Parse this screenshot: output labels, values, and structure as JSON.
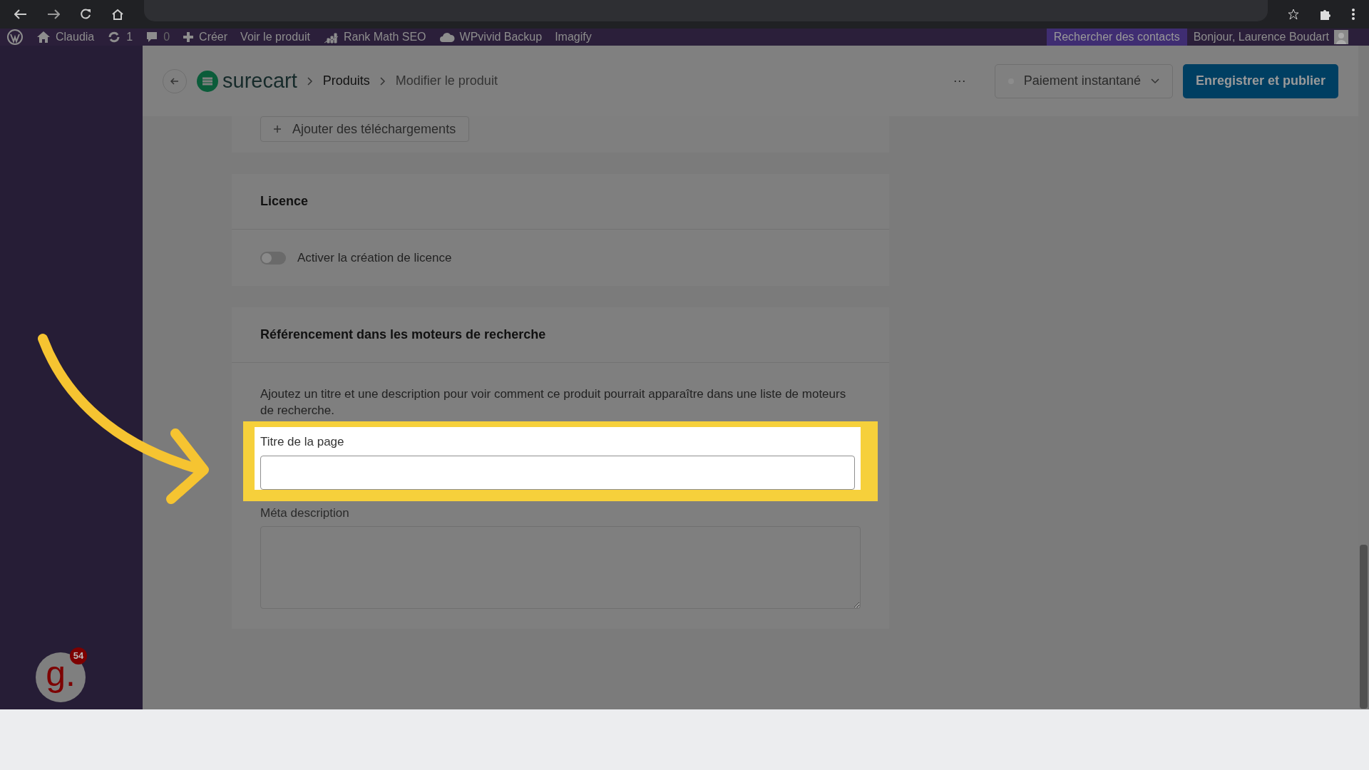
{
  "admin_bar": {
    "site": "Claudia",
    "updates": "1",
    "comments": "0",
    "items": [
      "Créer",
      "Voir le produit",
      "Rank Math SEO",
      "WPvivid Backup",
      "Imagify"
    ],
    "search_contacts": "Rechercher des contacts",
    "greeting": "Bonjour, Laurence Boudart"
  },
  "header": {
    "logo": "surecart",
    "breadcrumbs": [
      "Produits",
      "Modifier le produit"
    ],
    "more": "···",
    "status": "Paiement instantané",
    "publish": "Enregistrer et publier"
  },
  "downloads_button": "Ajouter des téléchargements",
  "licence": {
    "title": "Licence",
    "toggle_label": "Activer la création de licence",
    "on": false
  },
  "seo": {
    "title": "Référencement dans les moteurs de recherche",
    "description": "Ajoutez un titre et une description pour voir comment ce produit pourrait apparaître dans une liste de moteurs de recherche.",
    "fields": [
      {
        "kind": "input",
        "label": "Titre de la page",
        "highlighted": true
      },
      {
        "kind": "textarea",
        "label": "Méta description",
        "highlighted": false
      }
    ]
  },
  "widget": {
    "letter": "g.",
    "badge": "54"
  }
}
